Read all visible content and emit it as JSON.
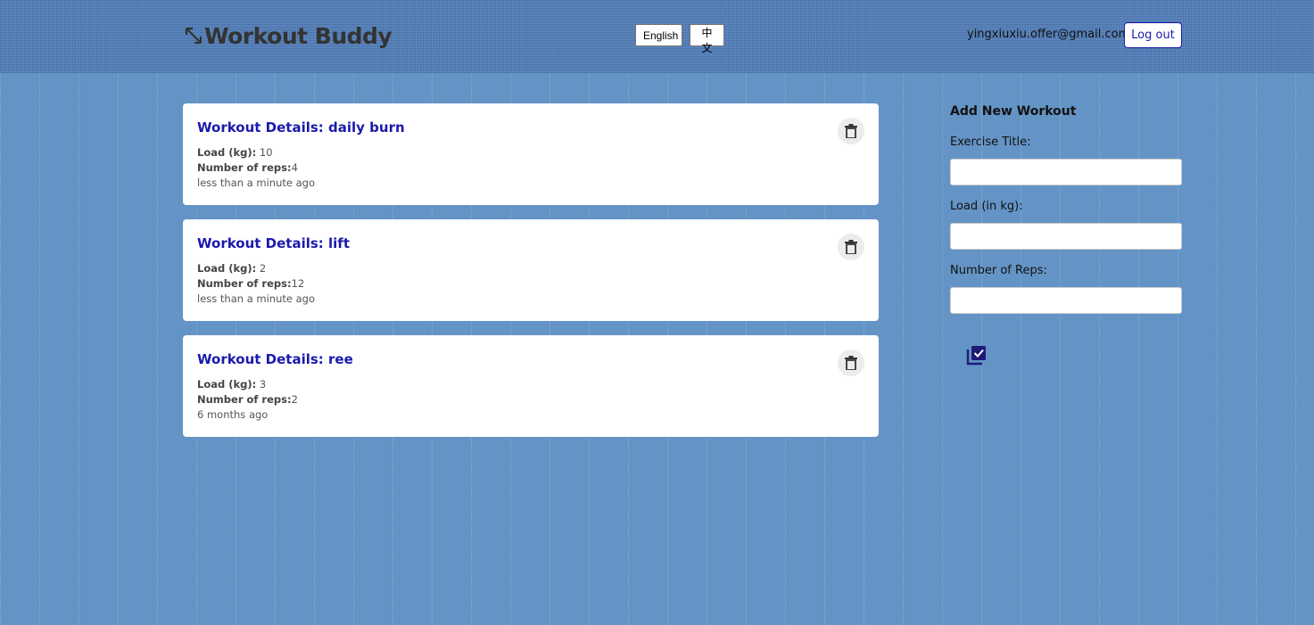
{
  "header": {
    "app_title": "Workout Buddy",
    "lang_english": "English",
    "lang_chinese": "中文",
    "user_email": "yingxiuxiu.offer@gmail.com",
    "logout_label": "Log out"
  },
  "workouts": [
    {
      "title": "Workout Details: daily burn",
      "load_label": "Load (kg):",
      "load_value": " 10",
      "reps_label": "Number of reps:",
      "reps_value": "4",
      "time": "less than a minute ago"
    },
    {
      "title": "Workout Details: lift",
      "load_label": "Load (kg):",
      "load_value": " 2",
      "reps_label": "Number of reps:",
      "reps_value": "12",
      "time": "less than a minute ago"
    },
    {
      "title": "Workout Details: ree",
      "load_label": "Load (kg):",
      "load_value": " 3",
      "reps_label": "Number of reps:",
      "reps_value": "2",
      "time": "6 months ago"
    }
  ],
  "form": {
    "title": "Add New Workout",
    "exercise_label": "Exercise Title:",
    "exercise_value": "",
    "load_label": "Load (in kg):",
    "load_value": "",
    "reps_label": "Number of Reps:",
    "reps_value": "",
    "submit_icon": "library-add-check-icon"
  },
  "colors": {
    "accent": "#1a1aad",
    "background": "#6494c6",
    "submit_icon": "#1e1a78"
  }
}
